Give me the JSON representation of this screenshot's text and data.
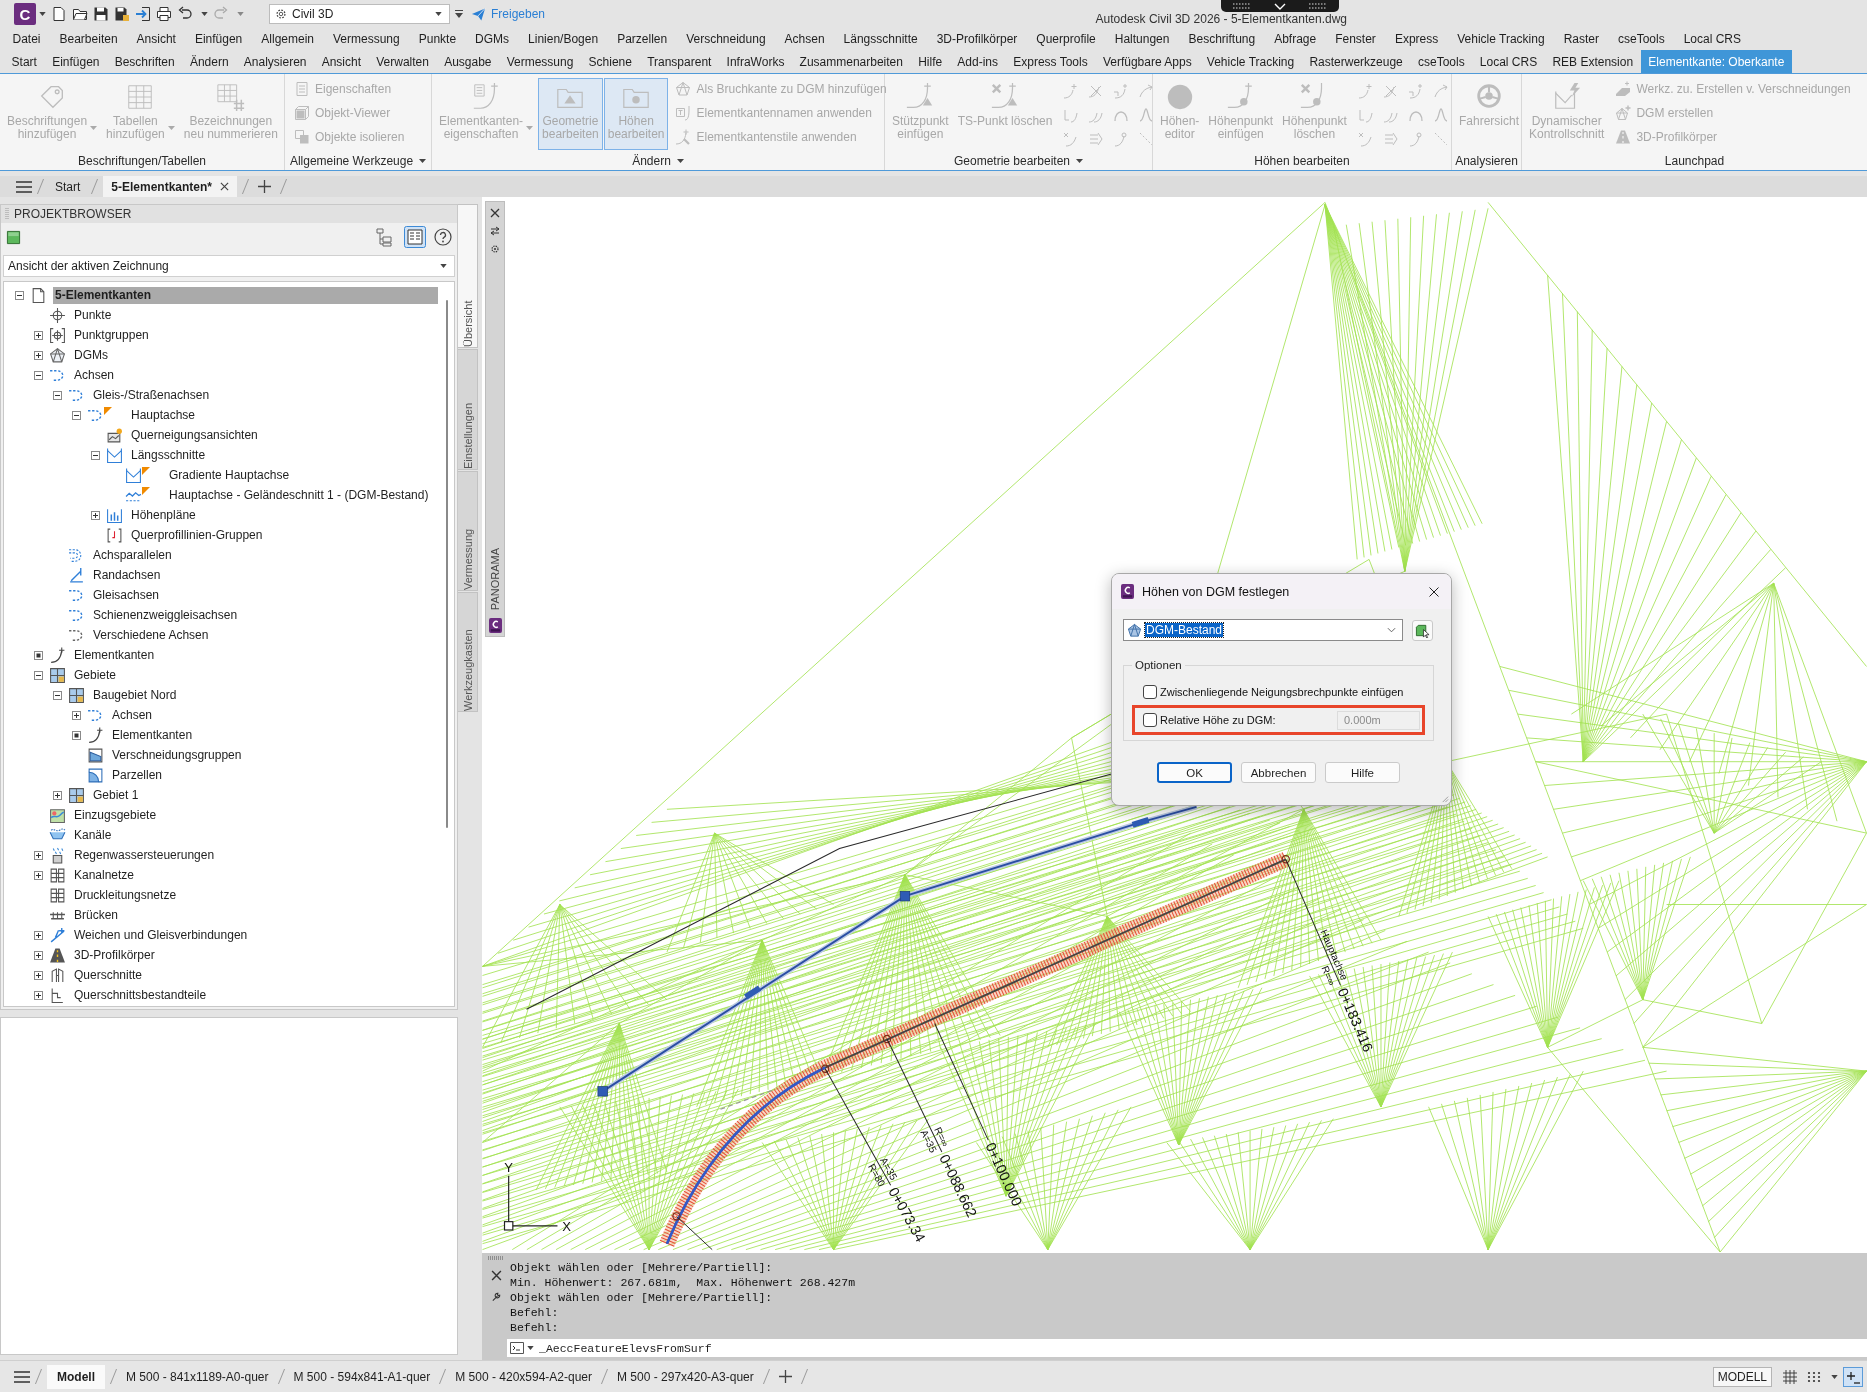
{
  "title_bar": {
    "app_letter": "C",
    "workspace": "Civil 3D",
    "share_label": "Freigeben",
    "title": "Autodesk Civil 3D 2026 - 5-Elementkanten.dwg"
  },
  "menu_bar": [
    "Datei",
    "Bearbeiten",
    "Ansicht",
    "Einfügen",
    "Allgemein",
    "Vermessung",
    "Punkte",
    "DGMs",
    "Linien/Bogen",
    "Parzellen",
    "Verschneidung",
    "Achsen",
    "Längsschnitte",
    "3D-Profilkörper",
    "Querprofile",
    "Haltungen",
    "Beschriftung",
    "Abfrage",
    "Fenster",
    "Express",
    "Vehicle Tracking",
    "Raster",
    "cseTools",
    "Local CRS"
  ],
  "ribbon_tabs": [
    {
      "label": "Start",
      "selected": false
    },
    {
      "label": "Einfügen",
      "selected": false
    },
    {
      "label": "Beschriften",
      "selected": false
    },
    {
      "label": "Ändern",
      "selected": false
    },
    {
      "label": "Analysieren",
      "selected": false
    },
    {
      "label": "Ansicht",
      "selected": false
    },
    {
      "label": "Verwalten",
      "selected": false
    },
    {
      "label": "Ausgabe",
      "selected": false
    },
    {
      "label": "Vermessung",
      "selected": false
    },
    {
      "label": "Schiene",
      "selected": false
    },
    {
      "label": "Transparent",
      "selected": false
    },
    {
      "label": "InfraWorks",
      "selected": false
    },
    {
      "label": "Zusammenarbeiten",
      "selected": false
    },
    {
      "label": "Hilfe",
      "selected": false
    },
    {
      "label": "Add-ins",
      "selected": false
    },
    {
      "label": "Express Tools",
      "selected": false
    },
    {
      "label": "Verfügbare Apps",
      "selected": false
    },
    {
      "label": "Vehicle Tracking",
      "selected": false
    },
    {
      "label": "Rasterwerkzeuge",
      "selected": false
    },
    {
      "label": "cseTools",
      "selected": false
    },
    {
      "label": "Local CRS",
      "selected": false
    },
    {
      "label": "REB Extension",
      "selected": false
    },
    {
      "label": "Elementkante: Oberkante",
      "selected": true
    }
  ],
  "ribbon_panels": [
    {
      "title": "Beschriftungen/Tabellen",
      "has_menu": false,
      "items": [
        {
          "kind": "large",
          "label": [
            "Beschriftungen",
            "hinzufügen"
          ],
          "dropdown": true,
          "disabled": true,
          "selected": false
        },
        {
          "kind": "large",
          "label": [
            "Tabellen",
            "hinzufügen"
          ],
          "dropdown": true,
          "disabled": true,
          "selected": false
        },
        {
          "kind": "large",
          "label": [
            "Bezeichnungen",
            "neu nummerieren"
          ],
          "dropdown": false,
          "disabled": true,
          "selected": false
        }
      ]
    },
    {
      "title": "Allgemeine Werkzeuge",
      "has_menu": true,
      "items": [
        {
          "kind": "small",
          "label": [
            "Eigenschaften"
          ],
          "disabled": true,
          "selected": false
        },
        {
          "kind": "small",
          "label": [
            "Objekt-Viewer"
          ],
          "disabled": true,
          "selected": false
        },
        {
          "kind": "small",
          "label": [
            "Objekte isolieren"
          ],
          "disabled": true,
          "selected": false
        }
      ]
    },
    {
      "title": "Ändern",
      "has_menu": true,
      "items": [
        {
          "kind": "large",
          "label": [
            "Elementkanten-",
            "eigenschaften"
          ],
          "dropdown": true,
          "disabled": true,
          "selected": false
        },
        {
          "kind": "large",
          "label": [
            "Geometrie",
            "bearbeiten"
          ],
          "dropdown": false,
          "disabled": true,
          "selected": true
        },
        {
          "kind": "large",
          "label": [
            "Höhen",
            "bearbeiten"
          ],
          "dropdown": false,
          "disabled": true,
          "selected": true
        },
        {
          "kind": "small",
          "label": [
            "Als Bruchkante zu DGM hinzufügen"
          ],
          "disabled": true,
          "selected": false
        },
        {
          "kind": "small",
          "label": [
            "Elementkantennamen anwenden"
          ],
          "disabled": true,
          "selected": false
        },
        {
          "kind": "small",
          "label": [
            "Elementkantenstile anwenden"
          ],
          "disabled": true,
          "selected": false
        }
      ]
    },
    {
      "title": "Geometrie bearbeiten",
      "has_menu": true,
      "items": [
        {
          "kind": "large",
          "label": [
            "Stützpunkt",
            "einfügen"
          ],
          "dropdown": false,
          "disabled": true,
          "selected": false
        },
        {
          "kind": "large",
          "label": [
            "TS-Punkt löschen"
          ],
          "dropdown": false,
          "disabled": true,
          "selected": false
        },
        {
          "kind": "tool",
          "disabled": true,
          "selected": false
        },
        {
          "kind": "tool",
          "disabled": true,
          "selected": false
        },
        {
          "kind": "tool",
          "disabled": true,
          "selected": false
        },
        {
          "kind": "tool",
          "disabled": true,
          "selected": false
        },
        {
          "kind": "tool",
          "disabled": true,
          "selected": false
        },
        {
          "kind": "tool",
          "disabled": true,
          "selected": false
        },
        {
          "kind": "tool",
          "disabled": true,
          "selected": false
        },
        {
          "kind": "tool",
          "disabled": true,
          "selected": false
        },
        {
          "kind": "tool",
          "disabled": true,
          "selected": false
        },
        {
          "kind": "tool",
          "disabled": true,
          "selected": false
        },
        {
          "kind": "tool",
          "disabled": true,
          "selected": false
        },
        {
          "kind": "tool",
          "disabled": true,
          "selected": false
        }
      ]
    },
    {
      "title": "Höhen bearbeiten",
      "has_menu": false,
      "items": [
        {
          "kind": "large",
          "label": [
            "Höhen-",
            "editor"
          ],
          "dropdown": false,
          "disabled": true,
          "selected": false
        },
        {
          "kind": "large",
          "label": [
            "Höhenpunkt",
            "einfügen"
          ],
          "dropdown": false,
          "disabled": true,
          "selected": false
        },
        {
          "kind": "large",
          "label": [
            "Höhenpunkt",
            "löschen"
          ],
          "dropdown": false,
          "disabled": true,
          "selected": false
        },
        {
          "kind": "tool",
          "disabled": true,
          "selected": false
        },
        {
          "kind": "tool",
          "disabled": true,
          "selected": false
        },
        {
          "kind": "tool",
          "disabled": true,
          "selected": false
        },
        {
          "kind": "tool",
          "disabled": true,
          "selected": false
        },
        {
          "kind": "tool",
          "disabled": true,
          "selected": false
        },
        {
          "kind": "tool",
          "disabled": true,
          "selected": false
        },
        {
          "kind": "tool",
          "disabled": true,
          "selected": false
        },
        {
          "kind": "tool",
          "disabled": true,
          "selected": false
        },
        {
          "kind": "tool",
          "disabled": true,
          "selected": false
        },
        {
          "kind": "tool",
          "disabled": true,
          "selected": false
        },
        {
          "kind": "tool",
          "disabled": true,
          "selected": false
        },
        {
          "kind": "tool",
          "disabled": true,
          "selected": false
        }
      ]
    },
    {
      "title": "Analysieren",
      "has_menu": false,
      "items": [
        {
          "kind": "large",
          "label": [
            "Fahrersicht"
          ],
          "dropdown": false,
          "disabled": true,
          "selected": false
        }
      ]
    },
    {
      "title": "Launchpad",
      "has_menu": false,
      "items": [
        {
          "kind": "large",
          "label": [
            "Dynamischer",
            "Kontrollschnitt"
          ],
          "dropdown": false,
          "disabled": true,
          "selected": false
        },
        {
          "kind": "small",
          "label": [
            "Werkz. zu. Erstellen v. Verschneidungen"
          ],
          "disabled": true,
          "selected": false
        },
        {
          "kind": "small",
          "label": [
            "DGM erstellen"
          ],
          "disabled": true,
          "selected": false
        },
        {
          "kind": "small",
          "label": [
            "3D-Profilkörper"
          ],
          "disabled": true,
          "selected": false
        }
      ]
    }
  ],
  "file_tabs": [
    {
      "label": "Start",
      "selected": false,
      "closable": false
    },
    {
      "label": "5-Elementkanten*",
      "selected": true,
      "closable": true
    }
  ],
  "project_browser": {
    "title": "PROJEKTBROWSER",
    "view_toggles": [
      {
        "selected": false
      },
      {
        "selected": true
      }
    ],
    "view": "Ansicht der aktiven Zeichnung",
    "tree": [
      {
        "label": "5-Elementkanten",
        "selected": true,
        "flagged": false,
        "expanded": true,
        "unloaded": false,
        "children": [
          {
            "label": "Punkte",
            "selected": false,
            "flagged": false
          },
          {
            "label": "Punktgruppen",
            "selected": false,
            "flagged": false,
            "expanded": false,
            "unloaded": false
          },
          {
            "label": "DGMs",
            "selected": false,
            "flagged": false,
            "expanded": false,
            "unloaded": false
          },
          {
            "label": "Achsen",
            "selected": false,
            "flagged": false,
            "expanded": true,
            "unloaded": false,
            "children": [
              {
                "label": "Gleis-/Straßenachsen",
                "selected": false,
                "flagged": false,
                "expanded": true,
                "unloaded": false,
                "children": [
                  {
                    "label": "Hauptachse",
                    "selected": false,
                    "flagged": true,
                    "expanded": true,
                    "unloaded": false,
                    "children": [
                      {
                        "label": "Querneigungsansichten",
                        "selected": false,
                        "flagged": false
                      },
                      {
                        "label": "Längsschnitte",
                        "selected": false,
                        "flagged": false,
                        "expanded": true,
                        "unloaded": false,
                        "children": [
                          {
                            "label": "Gradiente Hauptachse",
                            "selected": false,
                            "flagged": true
                          },
                          {
                            "label": "Hauptachse - Geländeschnitt 1 - (DGM-Bestand)",
                            "selected": false,
                            "flagged": true
                          }
                        ]
                      },
                      {
                        "label": "Höhenpläne",
                        "selected": false,
                        "flagged": false,
                        "expanded": false,
                        "unloaded": false
                      },
                      {
                        "label": "Querprofillinien-Gruppen",
                        "selected": false,
                        "flagged": false
                      }
                    ]
                  }
                ]
              },
              {
                "label": "Achsparallelen",
                "selected": false,
                "flagged": false
              },
              {
                "label": "Randachsen",
                "selected": false,
                "flagged": false
              },
              {
                "label": "Gleisachsen",
                "selected": false,
                "flagged": false
              },
              {
                "label": "Schienenzweiggleisachsen",
                "selected": false,
                "flagged": false
              },
              {
                "label": "Verschiedene Achsen",
                "selected": false,
                "flagged": false
              }
            ]
          },
          {
            "label": "Elementkanten",
            "selected": false,
            "flagged": false,
            "expanded": false,
            "unloaded": true
          },
          {
            "label": "Gebiete",
            "selected": false,
            "flagged": false,
            "expanded": true,
            "unloaded": false,
            "children": [
              {
                "label": "Baugebiet Nord",
                "selected": false,
                "flagged": false,
                "expanded": true,
                "unloaded": false,
                "children": [
                  {
                    "label": "Achsen",
                    "selected": false,
                    "flagged": false,
                    "expanded": false,
                    "unloaded": false
                  },
                  {
                    "label": "Elementkanten",
                    "selected": false,
                    "flagged": false,
                    "expanded": false,
                    "unloaded": true
                  },
                  {
                    "label": "Verschneidungsgruppen",
                    "selected": false,
                    "flagged": false
                  },
                  {
                    "label": "Parzellen",
                    "selected": false,
                    "flagged": false
                  }
                ]
              },
              {
                "label": "Gebiet 1",
                "selected": false,
                "flagged": false,
                "expanded": false,
                "unloaded": false
              }
            ]
          },
          {
            "label": "Einzugsgebiete",
            "selected": false,
            "flagged": false
          },
          {
            "label": "Kanäle",
            "selected": false,
            "flagged": false
          },
          {
            "label": "Regenwassersteuerungen",
            "selected": false,
            "flagged": false,
            "expanded": false,
            "unloaded": false
          },
          {
            "label": "Kanalnetze",
            "selected": false,
            "flagged": false,
            "expanded": false,
            "unloaded": false
          },
          {
            "label": "Druckleitungsnetze",
            "selected": false,
            "flagged": false
          },
          {
            "label": "Brücken",
            "selected": false,
            "flagged": false
          },
          {
            "label": "Weichen und Gleisverbindungen",
            "selected": false,
            "flagged": false,
            "expanded": false,
            "unloaded": false
          },
          {
            "label": "3D-Profilkörper",
            "selected": false,
            "flagged": false,
            "expanded": false,
            "unloaded": false
          },
          {
            "label": "Querschnitte",
            "selected": false,
            "flagged": false,
            "expanded": false,
            "unloaded": false
          },
          {
            "label": "Querschnittsbestandteile",
            "selected": false,
            "flagged": false,
            "expanded": false,
            "unloaded": false
          }
        ]
      }
    ]
  },
  "side_tabs": [
    {
      "label": "Übersicht",
      "selected": true
    },
    {
      "label": "Einstellungen",
      "selected": false
    },
    {
      "label": "Vermessung",
      "selected": false
    },
    {
      "label": "Werkzeugkasten",
      "selected": false
    }
  ],
  "palette": {
    "title": "PANORAMA"
  },
  "drawing": {
    "station_labels": [
      {
        "above": "Hauptachse",
        "below": "R=∞",
        "station": "0+183.416"
      },
      {
        "above": "A=35",
        "below": "R=80",
        "station": "0+073.34"
      },
      {
        "above": "R=∞",
        "below": "A=35",
        "station": "0+088.662"
      },
      {
        "station": "0+100.000"
      }
    ],
    "ucs": {
      "x_label": "X",
      "y_label": "Y"
    }
  },
  "dialog": {
    "title": "Höhen von DGM festlegen",
    "surface": "DGM-Bestand",
    "surface_text_selected": true,
    "group_label": "Optionen",
    "options": [
      {
        "label": "Zwischenliegende Neigungsbrechpunkte einfügen",
        "checked": false,
        "highlighted": false
      },
      {
        "label": "Relative Höhe zu DGM:",
        "checked": false,
        "highlighted": true,
        "value": "0.000m",
        "value_disabled": true
      }
    ],
    "buttons": [
      {
        "label": "OK",
        "default": true
      },
      {
        "label": "Abbrechen",
        "default": false
      },
      {
        "label": "Hilfe",
        "default": false
      }
    ]
  },
  "command_line": {
    "history": [
      "Objekt wählen oder [Mehrere/Partiell]:",
      "Min. Höhenwert: 267.681m,  Max. Höhenwert 268.427m",
      "Objekt wählen oder [Mehrere/Partiell]:",
      "Befehl:",
      "Befehl:"
    ],
    "input": "_AeccFeatureElevsFromSurf"
  },
  "status_bar": {
    "layout_tabs": [
      {
        "label": "Modell",
        "selected": true
      },
      {
        "label": "M 500 - 841x1189-A0-quer",
        "selected": false
      },
      {
        "label": "M 500 - 594x841-A1-quer",
        "selected": false
      },
      {
        "label": "M 500 - 420x594-A2-quer",
        "selected": false
      },
      {
        "label": "M 500 - 297x420-A3-quer",
        "selected": false
      }
    ],
    "space": "MODELL",
    "toggles": [
      {
        "on": false
      },
      {
        "on": false
      },
      {
        "on": true
      }
    ]
  }
}
